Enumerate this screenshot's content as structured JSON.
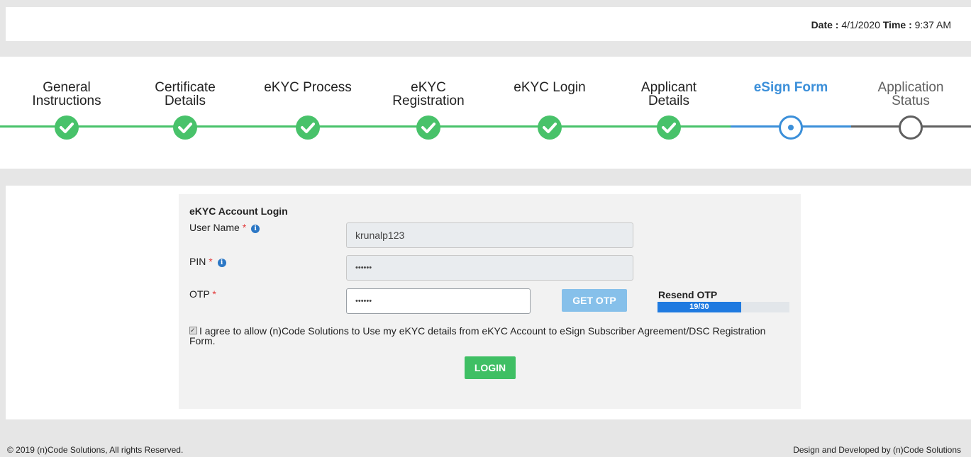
{
  "header": {
    "date_label": "Date :",
    "date_value": "4/1/2020",
    "time_label": "Time :",
    "time_value": "9:37 AM"
  },
  "steps": [
    {
      "label": "General\nInstructions",
      "state": "done"
    },
    {
      "label": "Certificate\nDetails",
      "state": "done"
    },
    {
      "label": "eKYC Process",
      "state": "done"
    },
    {
      "label": "eKYC\nRegistration",
      "state": "done"
    },
    {
      "label": "eKYC Login",
      "state": "done"
    },
    {
      "label": "Applicant\nDetails",
      "state": "done"
    },
    {
      "label": "eSign Form",
      "state": "current"
    },
    {
      "label": "Application\nStatus",
      "state": "pending"
    }
  ],
  "colors": {
    "done": "#48c26a",
    "current": "#3b8fd9",
    "pending": "#606060"
  },
  "form": {
    "title": "eKYC Account Login",
    "username_label": "User Name",
    "username_value": "krunalp123",
    "pin_label": "PIN",
    "pin_value": "••••••",
    "otp_label": "OTP",
    "otp_value": "••••••",
    "required_mark": "*",
    "info_glyph": "i",
    "get_otp_button": "GET OTP",
    "resend_label": "Resend OTP",
    "resend_progress_text": "19/30",
    "resend_progress_fraction": 0.633,
    "agree_text": "I agree to allow (n)Code Solutions to Use my eKYC details from eKYC Account to eSign Subscriber Agreement/DSC Registration Form.",
    "agree_checked": true,
    "login_button": "LOGIN"
  },
  "footer": {
    "copyright": "© 2019 (n)Code Solutions, All rights Reserved.",
    "credit": "Design and Developed by (n)Code Solutions"
  }
}
